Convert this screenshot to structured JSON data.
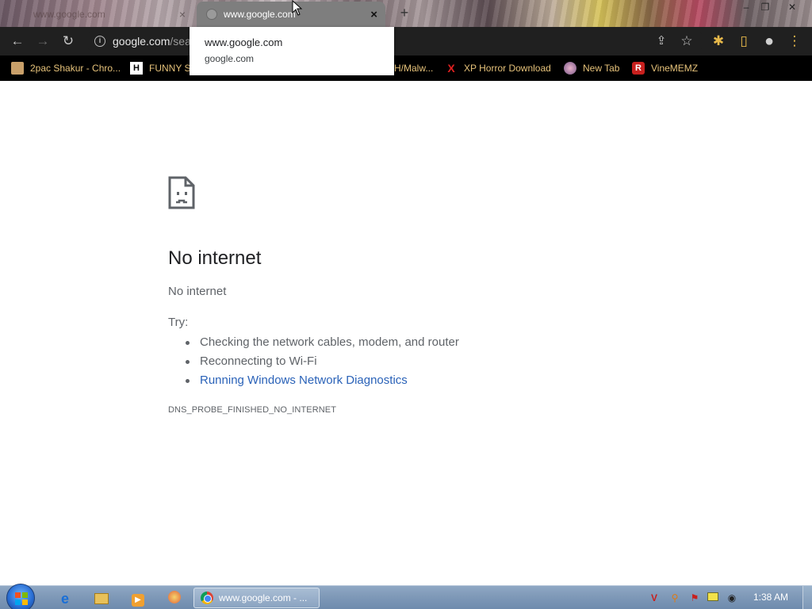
{
  "tabs": {
    "inactive_title": "www.google.com",
    "active_title": "www.google.com",
    "close_glyph": "×",
    "new_tab_glyph": "+"
  },
  "window_controls": {
    "minimize": "–",
    "restore": "❐",
    "close": "✕"
  },
  "toolbar": {
    "back_icon": "←",
    "forward_icon": "→",
    "reload_icon": "↻",
    "url_host": "google.com",
    "url_path": "/sea",
    "share_icon": "⇪",
    "star_icon": "☆",
    "extensions_icon": "✱",
    "sidepanel_icon": "▯",
    "profile_icon": "●",
    "menu_icon": "⋮"
  },
  "bookmarks": [
    {
      "label": "2pac Shakur - Chro...",
      "icon": "folder-icon"
    },
    {
      "label": "FUNNY SI",
      "icon": "H"
    },
    {
      "label": "H/Malw...",
      "icon": ""
    },
    {
      "label": "XP Horror Download",
      "icon": "X"
    },
    {
      "label": "New Tab",
      "icon": "globe-icon"
    },
    {
      "label": "VineMEMZ",
      "icon": "R"
    }
  ],
  "popup": {
    "line1": "www.google.com",
    "line2": "google.com"
  },
  "error_page": {
    "title": "No internet",
    "subtitle": "No internet",
    "try_label": "Try:",
    "suggestions": [
      "Checking the network cables, modem, and router",
      "Reconnecting to Wi-Fi",
      "Running Windows Network Diagnostics"
    ],
    "error_code": "DNS_PROBE_FINISHED_NO_INTERNET"
  },
  "taskbar": {
    "chrome_label": "www.google.com - ...",
    "clock": "1:38 AM"
  },
  "colors": {
    "toolbar_bg": "#202020",
    "bookmark_text": "#e6c27a",
    "link": "#2a62b8",
    "error_text": "#5f6368",
    "taskbar": "#7f99b8"
  }
}
